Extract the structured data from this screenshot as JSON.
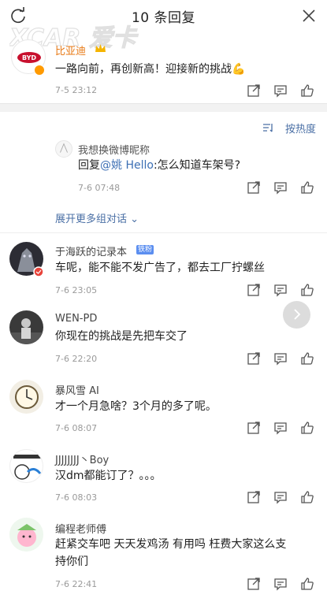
{
  "header": {
    "title": "10 条回复",
    "refresh_icon": "refresh-icon",
    "close_icon": "close-icon"
  },
  "watermark": {
    "text": "XCAR 爱卡"
  },
  "original_post": {
    "author": "比亚迪",
    "avatar_logo_text": "BYD",
    "text": "一路向前，再创新高！迎接新的挑战💪",
    "time": "7-5 23:12"
  },
  "sort": {
    "label": "按热度",
    "icon": "sort-icon"
  },
  "sub_reply": {
    "author": "我想换微博昵称",
    "prefix": "回复",
    "mention": "@姚 Hello",
    "text": ":怎么知道车架号?",
    "time": "7-6 07:48",
    "expand_label": "展开更多组对话 ⌄"
  },
  "comments": [
    {
      "author": "于海跃的记录本",
      "badge": "铁粉",
      "text": "车呢，能不能不发广告了，都去工厂拧螺丝",
      "time": "7-6 23:05"
    },
    {
      "author": "WEN-PD",
      "text": "你现在的挑战是先把车交了",
      "time": "7-6 22:20"
    },
    {
      "author": "暴风雪 AI",
      "text": "才一个月急啥？3个月的多了呢。",
      "time": "7-6 08:07"
    },
    {
      "author": "JJJJJJJJ丶Boy",
      "text": "汉dm都能订了？。。。",
      "time": "7-6 08:03"
    },
    {
      "author": "编程老师傅",
      "text_line1": "赶紧交车吧 天天发鸡汤 有用吗 枉费大家这么支",
      "text_line2": "持你们",
      "time": "7-6 22:41"
    }
  ],
  "colors": {
    "link": "#4a6fa5",
    "op_name": "#e87a16",
    "time": "#9a9a9a",
    "gap": "#f2f2f2"
  }
}
